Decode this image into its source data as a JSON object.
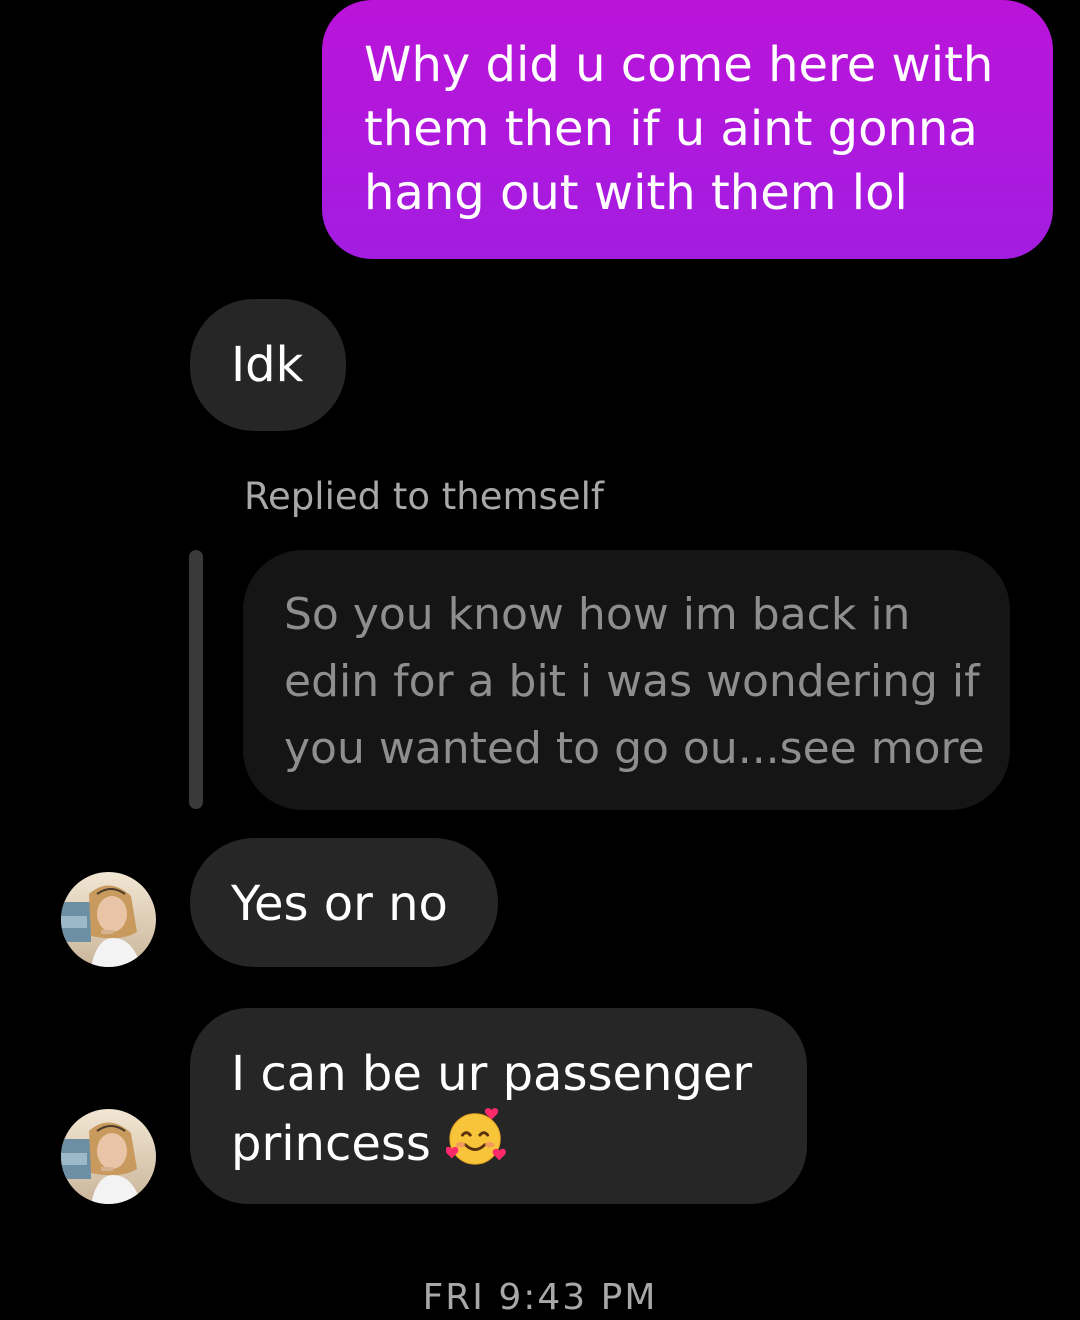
{
  "messages": {
    "sent_1": "Why did u come here with them then if u aint gonna hang out with them lol",
    "received_1": "Idk",
    "reply_label": "Replied to themself",
    "quoted_text": "So you know  how im back in edin for a bit i was wondering if you wanted to go ou...see more",
    "received_2": "Yes or no",
    "received_3": "I can be ur passenger princess"
  },
  "emoji": {
    "name": "smiling-face-with-hearts",
    "char": "🥰"
  },
  "timestamp": "FRI 9:43 PM",
  "colors": {
    "sent_bubble_top": "#bb14d9",
    "sent_bubble_bottom": "#a31de0",
    "received_bubble": "#262626",
    "quoted_bubble": "#151515",
    "muted_text": "#a8a8a8",
    "background": "#000000"
  }
}
